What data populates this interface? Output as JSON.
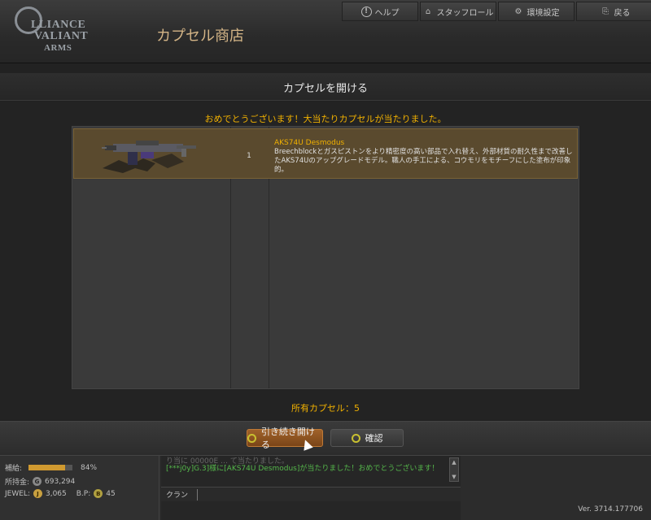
{
  "header": {
    "logo_line1": "LLIANCE",
    "logo_line2": "VALIANT",
    "logo_line3": "ARMS",
    "shop_title": "カプセル商店",
    "nav": [
      {
        "label": "ヘルプ",
        "icon": "help-icon"
      },
      {
        "label": "スタッフロール",
        "icon": "home-icon"
      },
      {
        "label": "環境設定",
        "icon": "gear-icon"
      },
      {
        "label": "戻る",
        "icon": "exit-icon"
      }
    ]
  },
  "dialog": {
    "title": "カプセルを開ける",
    "congrats": "おめでとうございます！大当たりカプセルが当たりました。",
    "item": {
      "quantity": "1",
      "name": "AKS74U Desmodus",
      "description": " Breechblockとガスピストンをより精密度の高い部品で入れ替え、外部材質の耐久性まで改善したAKS74Uのアップグレードモデル。職人の手工による、コウモリをモチーフにした塗布が印象的。"
    },
    "owned_label": "所有カプセル：5"
  },
  "actions": {
    "continue_label": "引き続き開ける",
    "confirm_label": "確認"
  },
  "status": {
    "supply_label": "補給:",
    "supply_percent": "84%",
    "supply_fraction": 0.84,
    "money_label": "所持金:",
    "money_value": "693,294",
    "jewel_label": "JEWEL:",
    "jewel_value": "3,065",
    "bp_label": "B.P:",
    "bp_value": "45"
  },
  "chat": {
    "faded_line": "り当に 00000E  …  て当たりました。",
    "message": "[***j0y]G.3]様に[AKS74U Desmodus]が当たりました！おめでとうございます！",
    "channel": "クラン"
  },
  "version": "Ver. 3714.177706",
  "colors": {
    "accent_gold": "#f0b000",
    "chat_green": "#55b84b",
    "selected_row": "#5a4a2e"
  }
}
